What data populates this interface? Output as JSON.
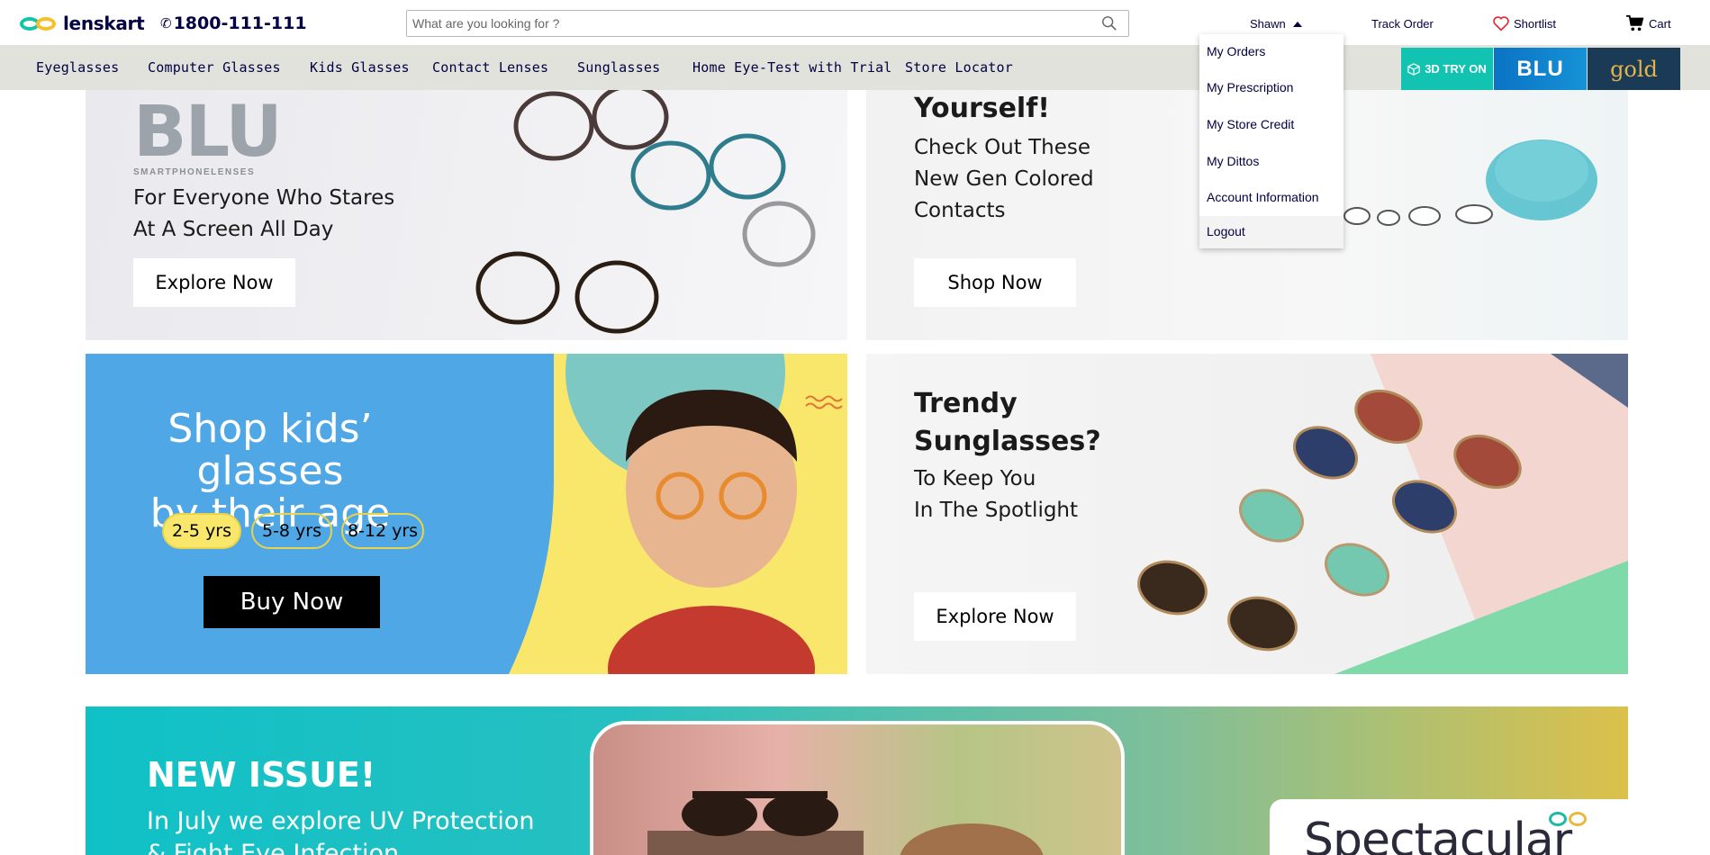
{
  "header": {
    "logo_text": "lenskart",
    "phone": "1800-111-111",
    "search_placeholder": "What are you looking for ?",
    "user_label": "Shawn",
    "track_order": "Track Order",
    "shortlist": "Shortlist",
    "cart": "Cart"
  },
  "nav": {
    "items": [
      {
        "label": "Eyeglasses"
      },
      {
        "label": "Computer Glasses"
      },
      {
        "label": "Kids Glasses"
      },
      {
        "label": "Contact Lenses"
      },
      {
        "label": "Sunglasses"
      },
      {
        "label": "Home Eye-Test with Trial"
      },
      {
        "label": "Store Locator"
      }
    ],
    "try_on": "3D TRY ON",
    "blu": "BLU",
    "gold": "gold"
  },
  "dropdown": {
    "items": [
      {
        "label": "My Orders"
      },
      {
        "label": "My Prescription"
      },
      {
        "label": "My Store Credit"
      },
      {
        "label": "My Dittos"
      },
      {
        "label": "Account Information"
      },
      {
        "label": "Logout"
      }
    ]
  },
  "banners": {
    "blu": {
      "logo": "BLU",
      "logo_sub": "SMARTPHONELENSES",
      "line1": "For Everyone Who Stares",
      "line2": "At A Screen All Day",
      "cta": "Explore Now"
    },
    "contacts": {
      "heading": "Yourself!",
      "line1": "Check Out These",
      "line2": "New Gen Colored",
      "line3": "Contacts",
      "cta": "Shop Now"
    },
    "kids": {
      "line1": "Shop kids’ glasses",
      "line2": "by their age",
      "ages": [
        "2-5 yrs",
        "5-8 yrs",
        "8-12 yrs"
      ],
      "cta": "Buy Now"
    },
    "sunglasses": {
      "heading1": "Trendy",
      "heading2": "Sunglasses?",
      "line1": "To Keep You",
      "line2": "In The Spotlight",
      "cta": "Explore Now"
    },
    "issue": {
      "heading": "NEW ISSUE!",
      "line1": "In July we explore UV Protection",
      "line2": "& Fight Eye Infection",
      "brand": "Spectacular"
    }
  },
  "colors": {
    "brand_navy": "#000042",
    "teal": "#11c3b0",
    "kids_blue": "#4fa7e6",
    "kids_yellow": "#f8e76a"
  }
}
